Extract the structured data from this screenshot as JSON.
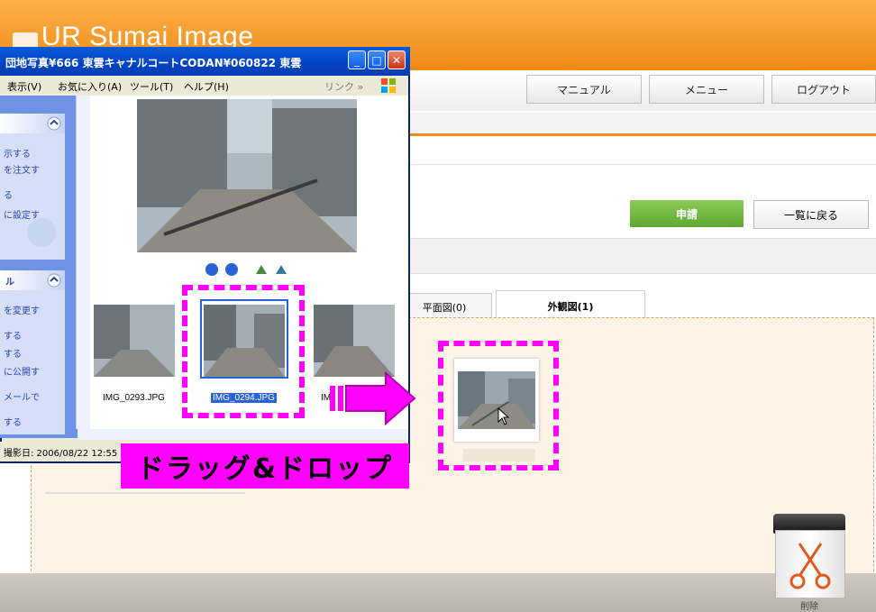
{
  "site": {
    "logo": "UR Sumai Image"
  },
  "nav": {
    "manual": "マニュアル",
    "menu": "メニュー",
    "logout": "ログアウト"
  },
  "actions": {
    "apply": "申請",
    "back": "一覧に戻る"
  },
  "tabs": [
    {
      "label": "平面図(0)"
    },
    {
      "label": "外観図(1)"
    }
  ],
  "trash": {
    "label": "削除"
  },
  "overlay": {
    "caption": "ドラッグ&ドロップ"
  },
  "xp_window": {
    "title": "団地写真¥666 東雲キャナルコートCODAN¥060822 東雲",
    "menu": [
      "表示(V)",
      "お気に入り(A)",
      "ツール(T)",
      "ヘルプ(H)"
    ],
    "links": "リンク »",
    "sidebar_panel1": [
      "示する",
      "を注文す",
      "る",
      "に設定す"
    ],
    "sidebar_panel2_head": "ル",
    "sidebar_panel2": [
      "を変更す",
      "する",
      "する",
      "に公開す",
      "メールで",
      "する"
    ],
    "thumbnails": [
      {
        "name": "IMG_0293.JPG"
      },
      {
        "name": "IMG_0294.JPG"
      },
      {
        "name": "IM"
      }
    ],
    "status": "撮影日: 2006/08/22 12:55"
  },
  "colors": {
    "header": "#f08a14",
    "xp_blue": "#0a5bd8",
    "highlight": "#ff00ff",
    "apply_green": "#5da732"
  }
}
